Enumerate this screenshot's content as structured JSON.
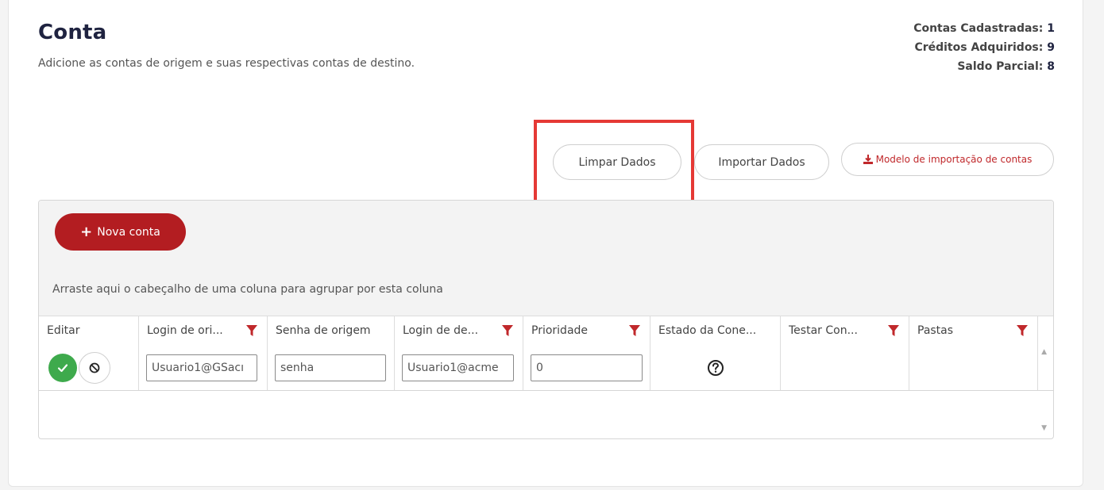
{
  "header": {
    "title": "Conta",
    "subtitle": "Adicione as contas de origem e suas respectivas contas de destino."
  },
  "stats": {
    "contas_label": "Contas Cadastradas:",
    "contas_value": "1",
    "creditos_label": "Créditos Adquiridos:",
    "creditos_value": "9",
    "saldo_label": "Saldo Parcial:",
    "saldo_value": "8"
  },
  "actions": {
    "limpar_label": "Limpar Dados",
    "importar_label": "Importar Dados",
    "modelo_label": "Modelo de importação de contas",
    "modelo_icon": "download-icon"
  },
  "grid": {
    "new_button_label": "Nova conta",
    "group_panel_text": "Arraste aqui o cabeçalho de uma coluna para agrupar por esta coluna",
    "columns": [
      "Editar",
      "Login de ori...",
      "Senha de origem",
      "Login de de...",
      "Prioridade",
      "Estado da Cone...",
      "Testar Con...",
      "Pastas"
    ],
    "row": {
      "login_origem": "Usuario1@GSacı",
      "senha_origem": "senha",
      "login_destino": "Usuario1@acme",
      "prioridade": "0",
      "estado_icon": "question-circle-icon"
    }
  },
  "colors": {
    "accent": "#b31d21",
    "confirm": "#3eaa4c",
    "highlight": "#e53935",
    "title": "#1f2340"
  }
}
